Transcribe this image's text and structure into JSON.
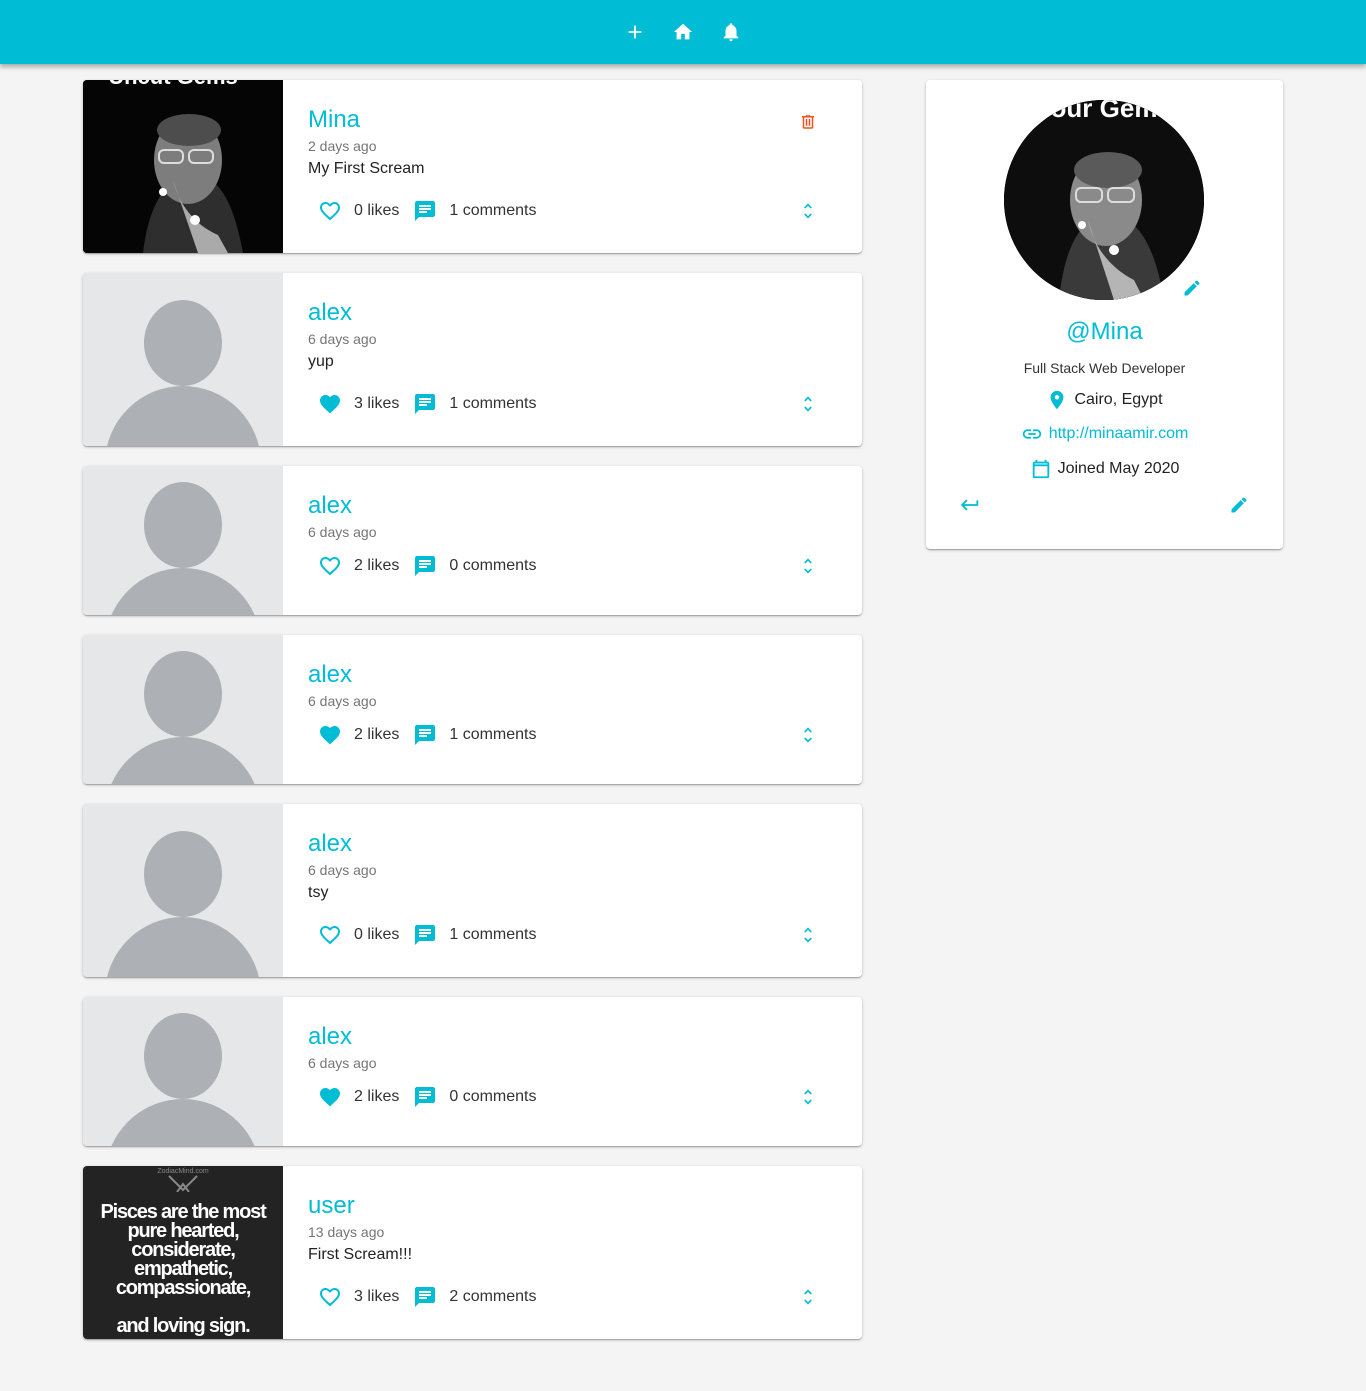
{
  "navbar": {
    "icons": [
      "add-icon",
      "home-icon",
      "notifications-icon"
    ]
  },
  "posts": [
    {
      "handle": "Mina",
      "time": "2 days ago",
      "body": "My First Scream",
      "likes": "0 likes",
      "comments": "1 comments",
      "liked": false,
      "image": "photo",
      "deletable": true
    },
    {
      "handle": "alex",
      "time": "6 days ago",
      "body": "yup",
      "likes": "3 likes",
      "comments": "1 comments",
      "liked": true,
      "image": "blank",
      "deletable": false
    },
    {
      "handle": "alex",
      "time": "6 days ago",
      "body": "",
      "likes": "2 likes",
      "comments": "0 comments",
      "liked": false,
      "image": "blank",
      "deletable": false
    },
    {
      "handle": "alex",
      "time": "6 days ago",
      "body": "",
      "likes": "2 likes",
      "comments": "1 comments",
      "liked": true,
      "image": "blank",
      "deletable": false
    },
    {
      "handle": "alex",
      "time": "6 days ago",
      "body": "tsy",
      "likes": "0 likes",
      "comments": "1 comments",
      "liked": false,
      "image": "blank",
      "deletable": false
    },
    {
      "handle": "alex",
      "time": "6 days ago",
      "body": "",
      "likes": "2 likes",
      "comments": "0 comments",
      "liked": true,
      "image": "blank",
      "deletable": false
    },
    {
      "handle": "user",
      "time": "13 days ago",
      "body": "First Scream!!!",
      "likes": "3 likes",
      "comments": "2 comments",
      "liked": false,
      "image": "quote",
      "deletable": false
    }
  ],
  "quote_image": {
    "lines": [
      "Pisces are the most",
      "pure hearted,",
      "considerate, empathetic,",
      "compassionate,",
      "",
      "and loving sign."
    ]
  },
  "profile": {
    "handle": "@Mina",
    "bio": "Full Stack Web Developer",
    "location": "Cairo, Egypt",
    "website": "http://minaamir.com",
    "joined": "Joined May 2020"
  },
  "colors": {
    "primary": "#00bcd4",
    "delete": "#f4511e",
    "background": "#f4f4f4"
  }
}
